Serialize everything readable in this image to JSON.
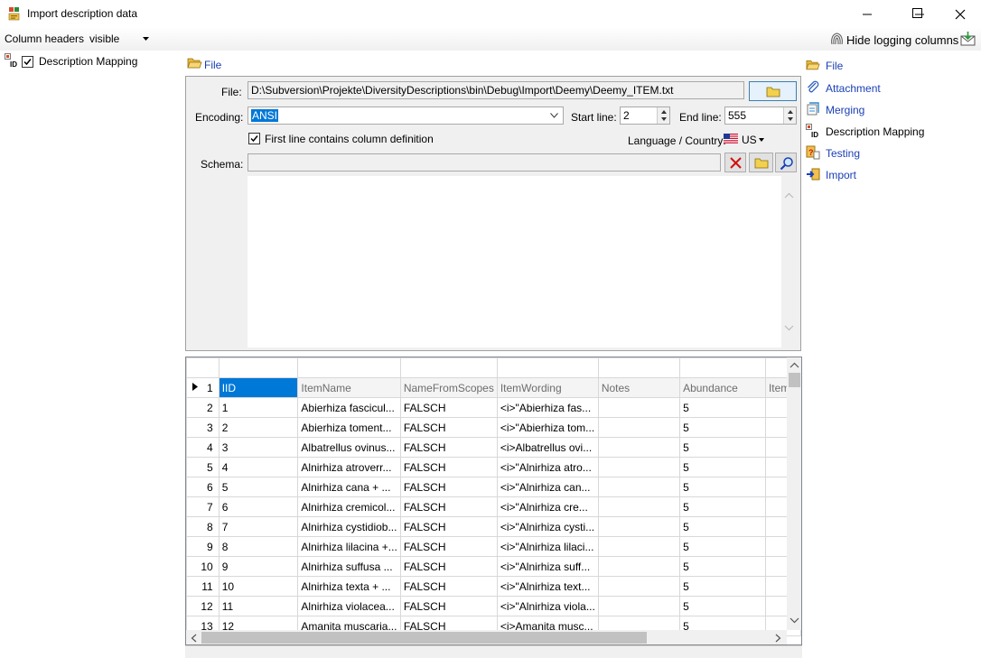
{
  "window": {
    "title": "Import description data"
  },
  "toolbar": {
    "column_headers_label": "Column headers",
    "column_headers_value": "visible",
    "hide_logging_label": "Hide logging columns"
  },
  "tree": {
    "item_label": "Description Mapping",
    "checked": true
  },
  "file_section": {
    "header_label": "File",
    "file_label": "File:",
    "file_path": "D:\\Subversion\\Projekte\\DiversityDescriptions\\bin\\Debug\\Import\\Deemy\\Deemy_ITEM.txt",
    "encoding_label": "Encoding:",
    "encoding_value": "ANSI",
    "start_line_label": "Start line:",
    "start_line_value": "2",
    "end_line_label": "End line:",
    "end_line_value": "555",
    "first_line_label": "First line contains column definition",
    "first_line_checked": true,
    "language_label": "Language / Country:",
    "language_value": "US",
    "schema_label": "Schema:",
    "schema_value": ""
  },
  "nav": {
    "items": [
      {
        "label": "File",
        "icon": "folder-open-icon"
      },
      {
        "label": "Attachment",
        "icon": "paperclip-icon"
      },
      {
        "label": "Merging",
        "icon": "merge-icon"
      },
      {
        "label": "Description Mapping",
        "icon": "id-mapping-icon"
      },
      {
        "label": "Testing",
        "icon": "testing-icon"
      },
      {
        "label": "Import",
        "icon": "import-icon"
      }
    ]
  },
  "grid": {
    "header_row_number": "1",
    "columns": [
      "IID",
      "ItemName",
      "NameFromScopes",
      "ItemWording",
      "Notes",
      "Abundance",
      "ItemI"
    ],
    "rows": [
      [
        "2",
        "1",
        "Abierhiza fascicul...",
        "FALSCH",
        "<i>\"Abierhiza fas...",
        "",
        "5"
      ],
      [
        "3",
        "2",
        "Abierhiza toment...",
        "FALSCH",
        "<i>\"Abierhiza tom...",
        "",
        "5"
      ],
      [
        "4",
        "3",
        "Albatrellus ovinus...",
        "FALSCH",
        "<i>Albatrellus ovi...",
        "",
        "5"
      ],
      [
        "5",
        "4",
        "Alnirhiza atroverr...",
        "FALSCH",
        "<i>\"Alnirhiza atro...",
        "",
        "5"
      ],
      [
        "6",
        "5",
        "Alnirhiza cana + ...",
        "FALSCH",
        "<i>\"Alnirhiza can...",
        "",
        "5"
      ],
      [
        "7",
        "6",
        "Alnirhiza cremicol...",
        "FALSCH",
        "<i>\"Alnirhiza cre...",
        "",
        "5"
      ],
      [
        "8",
        "7",
        "Alnirhiza cystidiob...",
        "FALSCH",
        "<i>\"Alnirhiza cysti...",
        "",
        "5"
      ],
      [
        "9",
        "8",
        "Alnirhiza lilacina +...",
        "FALSCH",
        "<i>\"Alnirhiza lilaci...",
        "",
        "5"
      ],
      [
        "10",
        "9",
        "Alnirhiza suffusa ...",
        "FALSCH",
        "<i>\"Alnirhiza suff...",
        "",
        "5"
      ],
      [
        "11",
        "10",
        "Alnirhiza texta + ...",
        "FALSCH",
        "<i>\"Alnirhiza text...",
        "",
        "5"
      ],
      [
        "12",
        "11",
        "Alnirhiza violacea...",
        "FALSCH",
        "<i>\"Alnirhiza viola...",
        "",
        "5"
      ],
      [
        "13",
        "12",
        "Amanita muscaria...",
        "FALSCH",
        "<i>Amanita musc...",
        "",
        "5"
      ]
    ]
  },
  "colors": {
    "accent": "#0078d7",
    "link": "#1a3fb5",
    "panel_bg": "#f0f0f0"
  }
}
